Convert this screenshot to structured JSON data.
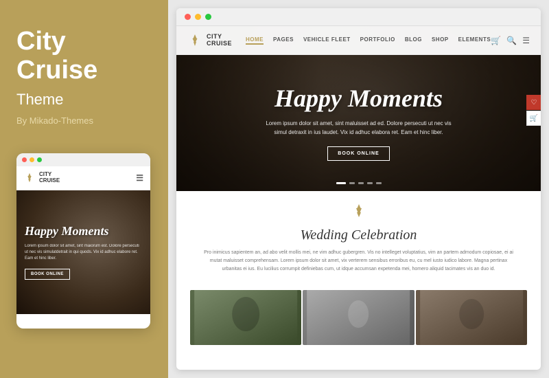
{
  "left": {
    "title_line1": "City",
    "title_line2": "Cruise",
    "subtitle": "Theme",
    "author": "By Mikado-Themes",
    "mobile_logo_line1": "CITY",
    "mobile_logo_line2": "CRUISE",
    "mobile_hero_title": "Happy Moments",
    "mobile_hero_text": "Lorem ipsum dolor sit amet, sint\nmaiorum est. Dolore persecuti ut nec\nvis simulatdetrait in qui quods. Vix id\nadhuc elabore ret. Eam et hinc liber.",
    "mobile_book_btn": "BOOK ONLINE"
  },
  "browser": {
    "dots": [
      "red",
      "yellow",
      "green"
    ],
    "site": {
      "logo_line1": "CITY",
      "logo_line2": "CRUISE",
      "nav_links": [
        {
          "label": "HOME",
          "active": true
        },
        {
          "label": "PAGES",
          "active": false
        },
        {
          "label": "VEHICLE FLEET",
          "active": false
        },
        {
          "label": "PORTFOLIO",
          "active": false
        },
        {
          "label": "BLOG",
          "active": false
        },
        {
          "label": "SHOP",
          "active": false
        },
        {
          "label": "ELEMENTS",
          "active": false
        }
      ],
      "hero_title": "Happy Moments",
      "hero_text": "Lorem ipsum dolor sit amet, sint maluisset ad ed. Dolore persecuti ut nec vis simul detraxit\nin ius laudet. Vix id adhuc elabora ret. Eam et hinc liber.",
      "hero_book_btn": "BOOK ONLINE",
      "hero_dots": [
        true,
        false,
        false,
        false,
        false
      ],
      "wedding_section_title": "Wedding Celebration",
      "wedding_text": "Pro inimicus sapientem an, ad abo velit mollis mei, ne vim adhuc gubergren. Vis no intelleget voluptatius, vim an partem admodum copiosae, ei\nai mutat maluisset comprehensam. Lorem ipsum dolor sit amet, vix verterem sensibus erroribus eu, cu mel iusto iudico labore. Magna pertinax\nurbanitas ei ius. Eu lucilius corrumpit definiebas cum, ut idque accumsan expetenda mei, homero aliquid tacimates vis an duo id.",
      "floating_icon1": "♡",
      "floating_icon2": "🛒"
    }
  }
}
